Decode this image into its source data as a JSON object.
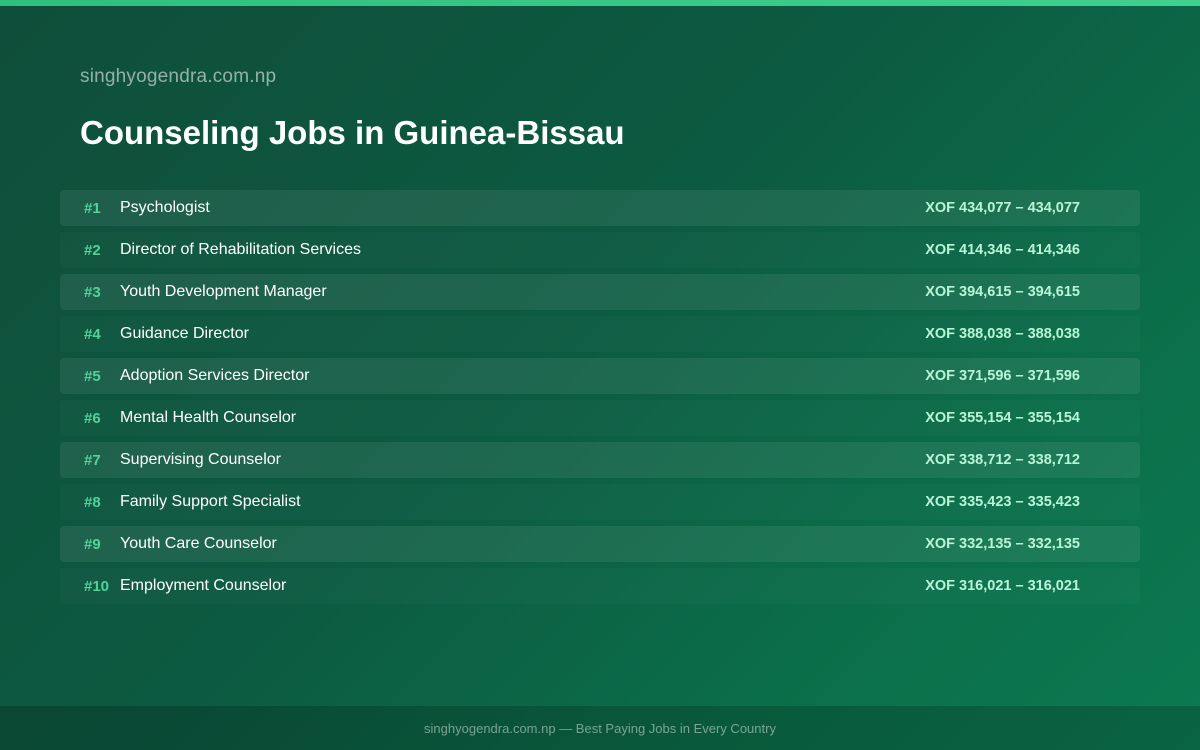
{
  "site_name": "singhyogendra.com.np",
  "page_title": "Counseling Jobs in Guinea-Bissau",
  "jobs": [
    {
      "rank": "#1",
      "title": "Psychologist",
      "salary": "XOF 434,077 – 434,077"
    },
    {
      "rank": "#2",
      "title": "Director of Rehabilitation Services",
      "salary": "XOF 414,346 – 414,346"
    },
    {
      "rank": "#3",
      "title": "Youth Development Manager",
      "salary": "XOF 394,615 – 394,615"
    },
    {
      "rank": "#4",
      "title": "Guidance Director",
      "salary": "XOF 388,038 – 388,038"
    },
    {
      "rank": "#5",
      "title": "Adoption Services Director",
      "salary": "XOF 371,596 – 371,596"
    },
    {
      "rank": "#6",
      "title": "Mental Health Counselor",
      "salary": "XOF 355,154 – 355,154"
    },
    {
      "rank": "#7",
      "title": "Supervising Counselor",
      "salary": "XOF 338,712 – 338,712"
    },
    {
      "rank": "#8",
      "title": "Family Support Specialist",
      "salary": "XOF 335,423 – 335,423"
    },
    {
      "rank": "#9",
      "title": "Youth Care Counselor",
      "salary": "XOF 332,135 – 332,135"
    },
    {
      "rank": "#10",
      "title": "Employment Counselor",
      "salary": "XOF 316,021 – 316,021"
    }
  ],
  "footer": {
    "text": "singhyogendra.com.np — Best Paying Jobs in Every Country"
  },
  "colors": {
    "accent": "#3fd08f",
    "rank": "#4fd39a",
    "salary": "#b8f5d6"
  }
}
